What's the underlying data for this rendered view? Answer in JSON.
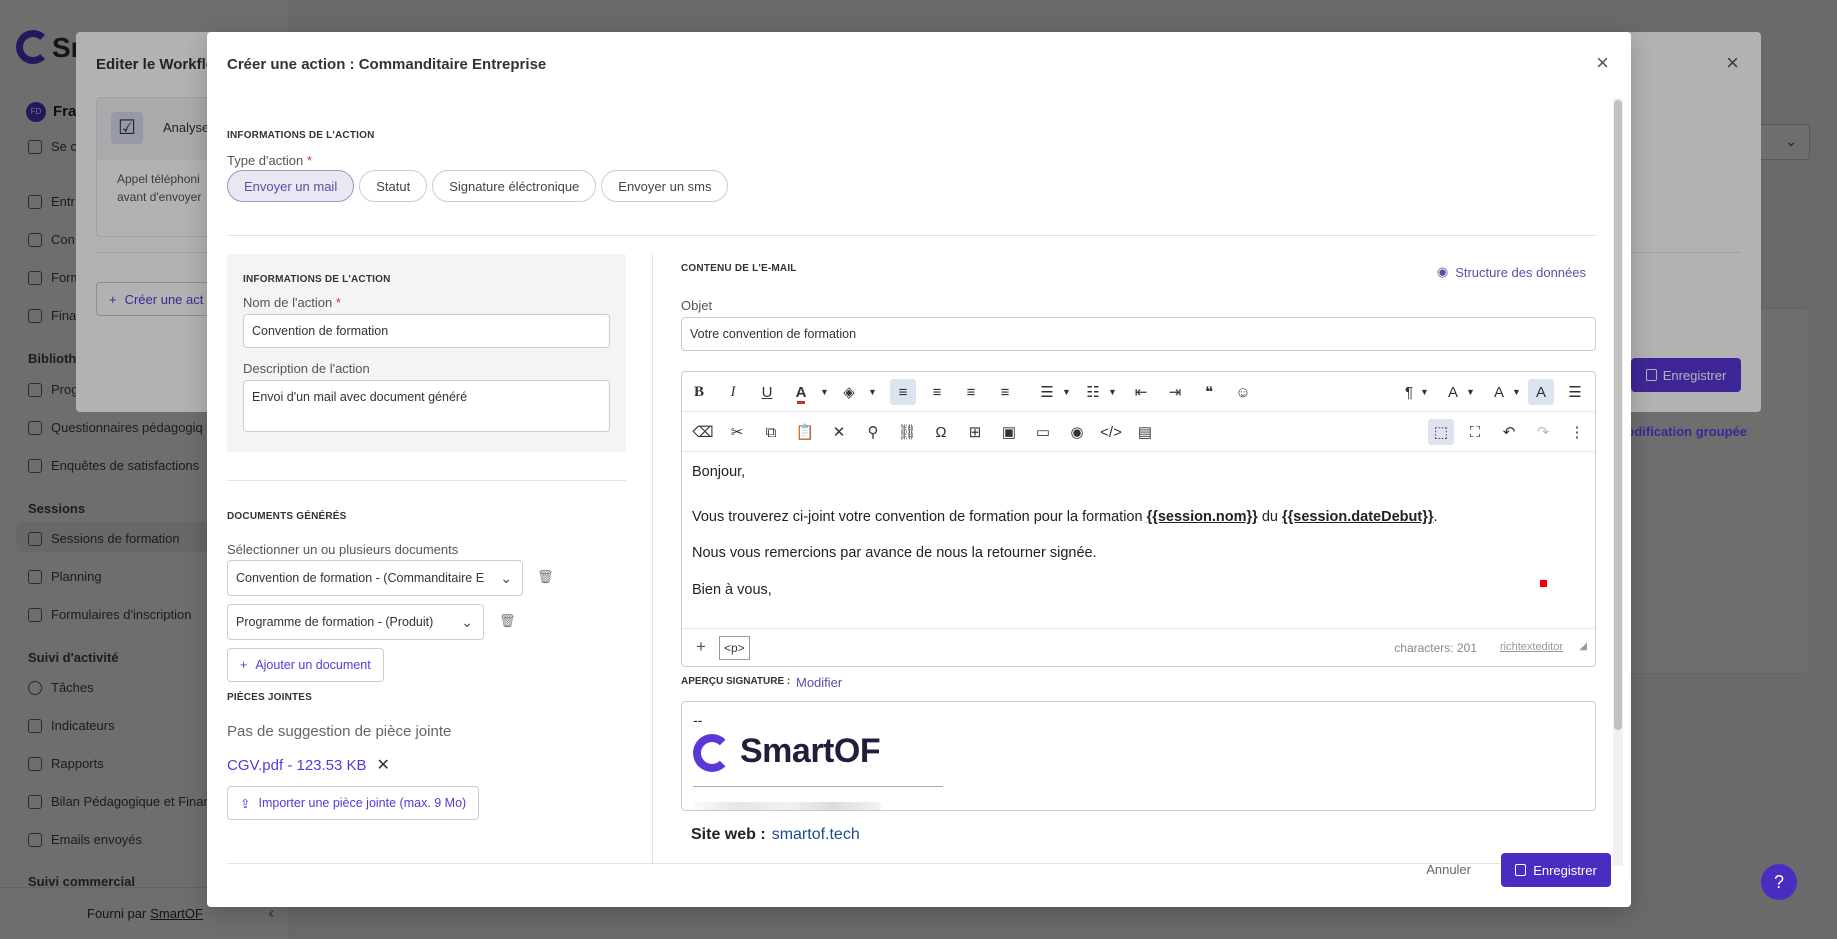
{
  "app": {
    "logo_text": "Sm",
    "org_initials": "FD",
    "org_name": "Fra",
    "sidebar_items": [
      {
        "label": "Se c"
      },
      {
        "label": "Entr"
      },
      {
        "label": "Con"
      },
      {
        "label": "Form"
      },
      {
        "label": "Fina"
      },
      {
        "label": "Bibliothè"
      },
      {
        "label": "Prog"
      },
      {
        "label": "Questionnaires pédagogiq"
      },
      {
        "label": "Enquêtes de satisfactions"
      },
      {
        "label": "Sessions"
      },
      {
        "label": "Sessions de formation"
      },
      {
        "label": "Planning"
      },
      {
        "label": "Formulaires d'inscription"
      },
      {
        "label": "Suivi d'activité"
      },
      {
        "label": "Tâches"
      },
      {
        "label": "Indicateurs"
      },
      {
        "label": "Rapports"
      },
      {
        "label": "Bilan Pédagogique et Finan"
      },
      {
        "label": "Emails envoyés"
      },
      {
        "label": "Suivi commercial"
      }
    ],
    "footer_text": "Fourni par",
    "footer_link": "SmartOF"
  },
  "workflow_modal": {
    "title": "Editer le Workflo",
    "card_label": "Analyse",
    "card_desc": "Appel téléphoni avant d'envoyer",
    "create_action_label": "Créer une act",
    "save_label": "Enregistrer",
    "bulk_edit_label": "Modification groupée"
  },
  "modal": {
    "title": "Créer une action : Commanditaire Entreprise",
    "section_action_info": "INFORMATIONS DE L'ACTION",
    "type_label": "Type d'action",
    "required_mark": "*",
    "types": [
      {
        "label": "Envoyer un mail",
        "active": true
      },
      {
        "label": "Statut",
        "active": false
      },
      {
        "label": "Signature éléctronique",
        "active": false
      },
      {
        "label": "Envoyer un sms",
        "active": false
      }
    ],
    "info_box_title": "INFORMATIONS DE L'ACTION",
    "name_label": "Nom de l'action",
    "name_value": "Convention de formation",
    "desc_label": "Description de l'action",
    "desc_value": "Envoi d'un mail avec document généré",
    "docs_section": "DOCUMENTS GÉNÉRÉS",
    "docs_select_label": "Sélectionner un ou plusieurs documents",
    "doc_1": "Convention de formation - (Commanditaire E",
    "doc_2": "Programme de formation - (Produit)",
    "add_doc_label": "Ajouter un document",
    "attachments_section": "PIÈCES JOINTES",
    "no_attachment_text": "Pas de suggestion de pièce jointe",
    "attachment_file": "CGV.pdf - 123.53 KB",
    "import_label": "Importer une pièce jointe (max. 9 Mo)",
    "content_section": "CONTENU DE L'E-MAIL",
    "structure_link": "Structure des données",
    "subject_label": "Objet",
    "subject_value": "Votre convention de formation",
    "body": {
      "line1": "Bonjour,",
      "line2_pre": "Vous trouverez ci-joint votre convention de formation pour la formation ",
      "var_name": "{{session.nom}}",
      "line2_mid": " du ",
      "var_date": "{{session.dateDebut}}",
      "line2_post": ".",
      "line3": "Nous vous remercions par avance de nous la retourner signée.",
      "line4": "Bien à vous,"
    },
    "editor_tag": "<p>",
    "char_count": "characters: 201",
    "editor_brand": "richtexteditor",
    "signature_label": "APERÇU SIGNATURE :",
    "signature_edit": "Modifier",
    "signature_dash": "--",
    "signature_logo_text": "SmartOF",
    "site_label": "Site web :",
    "site_url": "smartof.tech",
    "cancel_label": "Annuler",
    "save_label": "Enregistrer"
  },
  "icons": {
    "close": "close-icon",
    "eye": "eye-icon",
    "trash": "trash-icon",
    "plus": "plus-icon",
    "upload": "upload-icon",
    "save": "save-icon",
    "help": "help-icon"
  },
  "colors": {
    "primary": "#4a2cc2",
    "brand": "#5a37d8",
    "link": "#5a4fa6",
    "active_pill_bg": "#e8e8f2"
  }
}
